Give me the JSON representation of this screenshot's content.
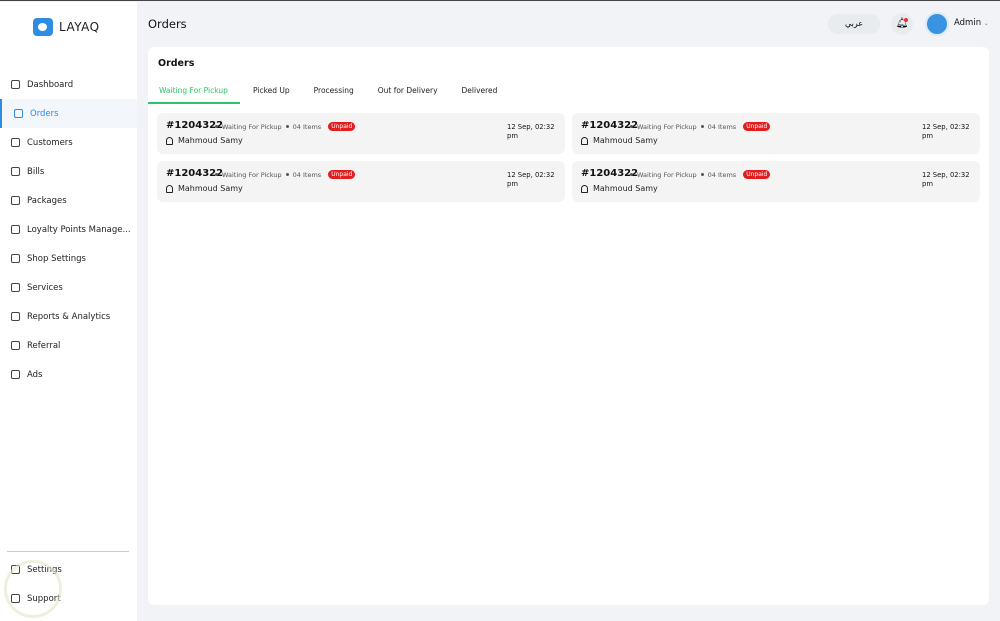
{
  "brand": {
    "name": "LAYAQ"
  },
  "sidebar": {
    "items": [
      {
        "label": "Dashboard",
        "icon": "grid-icon"
      },
      {
        "label": "Orders",
        "icon": "clipboard-icon",
        "active": true
      },
      {
        "label": "Customers",
        "icon": "id-card-icon"
      },
      {
        "label": "Bills",
        "icon": "bill-icon"
      },
      {
        "label": "Packages",
        "icon": "package-icon"
      },
      {
        "label": "Loyalty Points Manage...",
        "icon": "award-icon"
      },
      {
        "label": "Shop Settings",
        "icon": "shop-icon"
      },
      {
        "label": "Services",
        "icon": "briefcase-icon"
      },
      {
        "label": "Reports & Analytics",
        "icon": "chart-icon"
      },
      {
        "label": "Referral",
        "icon": "referral-icon"
      },
      {
        "label": "Ads",
        "icon": "megaphone-icon"
      }
    ],
    "bottom": [
      {
        "label": "Settings",
        "icon": "gear-icon"
      },
      {
        "label": "Support",
        "icon": "headset-icon"
      }
    ]
  },
  "header": {
    "title": "Orders",
    "language": "عربي",
    "user": "Admin"
  },
  "main": {
    "title": "Orders",
    "tabs": [
      "Waiting For Pickup",
      "Picked Up",
      "Processing",
      "Out for Delivery",
      "Delivered"
    ],
    "orders": [
      {
        "id": "#1204322",
        "status": "Waiting For Pickup",
        "items": "04 Items",
        "payment": "Unpaid",
        "customer": "Mahmoud Samy",
        "date": "12 Sep, 02:32 pm"
      },
      {
        "id": "#1204322",
        "status": "Waiting For Pickup",
        "items": "04 Items",
        "payment": "Unpaid",
        "customer": "Mahmoud Samy",
        "date": "12 Sep, 02:32 pm"
      },
      {
        "id": "#1204322",
        "status": "Waiting For Pickup",
        "items": "04 Items",
        "payment": "Unpaid",
        "customer": "Mahmoud Samy",
        "date": "12 Sep, 02:32 pm"
      },
      {
        "id": "#1204322",
        "status": "Waiting For Pickup",
        "items": "04 Items",
        "payment": "Unpaid",
        "customer": "Mahmoud Samy",
        "date": "12 Sep, 02:32 pm"
      }
    ]
  },
  "colors": {
    "accent": "#2e8de0",
    "tab_active": "#2ec46b",
    "unpaid": "#e31d1d"
  }
}
